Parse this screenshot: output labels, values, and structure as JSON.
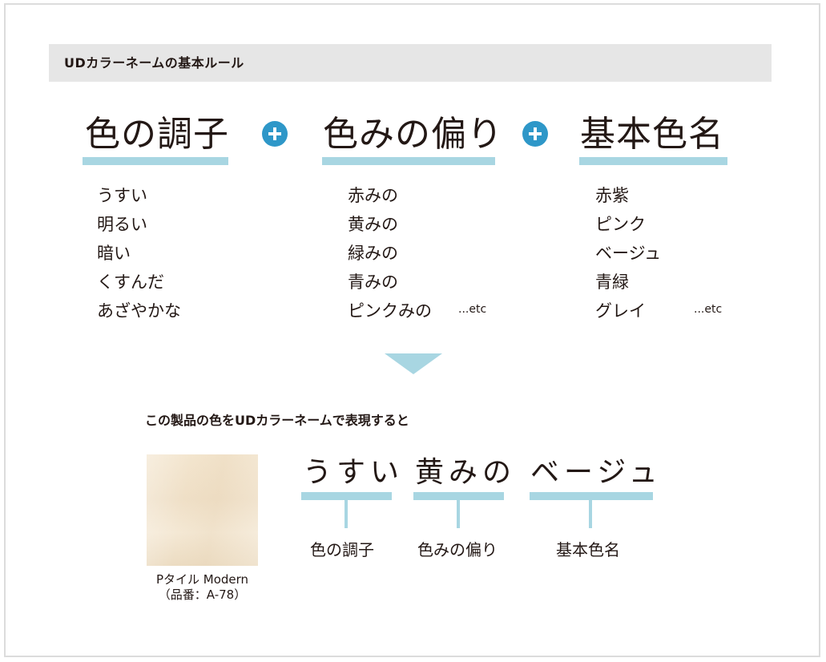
{
  "header": {
    "title": "UDカラーネームの基本ルール"
  },
  "columns": [
    {
      "heading": "色の調子",
      "items": [
        "うすい",
        "明るい",
        "暗い",
        "くすんだ",
        "あざやかな"
      ],
      "etc": ""
    },
    {
      "heading": "色みの偏り",
      "items": [
        "赤みの",
        "黄みの",
        "緑みの",
        "青みの",
        "ピンクみの"
      ],
      "etc": "...etc"
    },
    {
      "heading": "基本色名",
      "items": [
        "赤紫",
        "ピンク",
        "ベージュ",
        "青緑",
        "グレイ"
      ],
      "etc": "...etc"
    }
  ],
  "example": {
    "intro": "この製品の色をUDカラーネームで表現すると",
    "product_name": "Pタイル Modern",
    "product_code": "（品番：A-78）",
    "words": [
      {
        "text": "うすい",
        "label": "色の調子"
      },
      {
        "text": "黄みの",
        "label": "色みの偏り"
      },
      {
        "text": "ベージュ",
        "label": "基本色名"
      }
    ]
  },
  "colors": {
    "accent_blue": "#2e97c8",
    "light_blue": "#a8d6e2",
    "header_gray": "#e6e6e6",
    "swatch": "#f0e2ca"
  }
}
